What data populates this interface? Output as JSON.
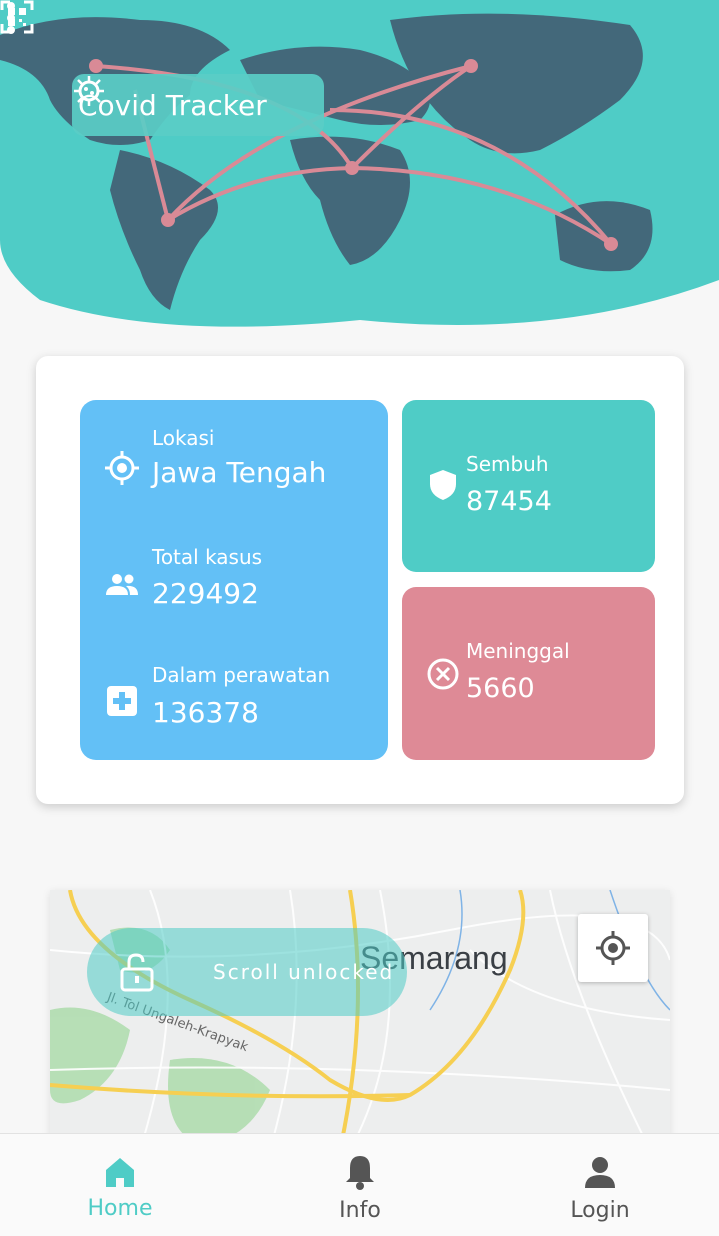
{
  "app": {
    "title": "Covid Tracker",
    "icons": {
      "title": "virus-icon",
      "qr": "qr-code-icon",
      "menu": "more-vert-icon"
    }
  },
  "stats": {
    "location": {
      "label": "Lokasi",
      "value": "Jawa Tengah",
      "icon": "location-target-icon"
    },
    "total": {
      "label": "Total kasus",
      "value": "229492",
      "icon": "people-icon"
    },
    "treated": {
      "label": "Dalam perawatan",
      "value": "136378",
      "icon": "medical-cross-icon"
    },
    "recovered": {
      "label": "Sembuh",
      "value": "87454",
      "icon": "shield-icon"
    },
    "deaths": {
      "label": "Meninggal",
      "value": "5660",
      "icon": "close-circle-icon"
    }
  },
  "map": {
    "city": "Semarang",
    "road": "Jl. Tol Ungaleh-Krapyak",
    "scroll_status": "Scroll unlocked",
    "icons": {
      "lock": "unlock-icon",
      "locate": "my-location-icon"
    }
  },
  "nav": {
    "items": [
      {
        "label": "Home",
        "icon": "home-icon",
        "active": true
      },
      {
        "label": "Info",
        "icon": "bell-icon",
        "active": false
      },
      {
        "label": "Login",
        "icon": "person-icon",
        "active": false
      }
    ]
  },
  "colors": {
    "teal": "#4fccc6",
    "blue": "#63c0f6",
    "pink": "#de8a96",
    "map_land": "#43687a"
  }
}
